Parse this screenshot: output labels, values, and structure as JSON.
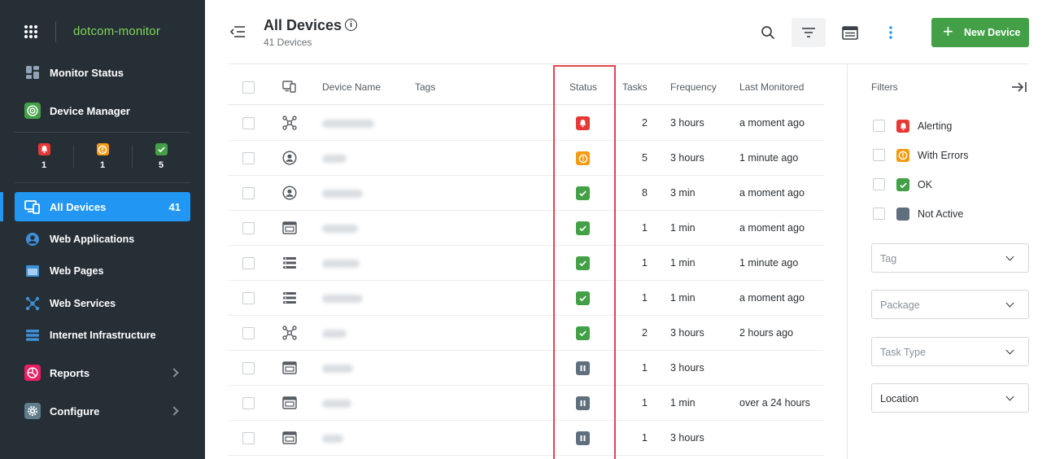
{
  "sidebar": {
    "logo_left": "dotcom",
    "logo_dash": "-",
    "logo_right": "monitor",
    "items": [
      {
        "label": "Monitor Status",
        "icon": "dashboard-icon"
      },
      {
        "label": "Device Manager",
        "icon": "target-icon"
      }
    ],
    "status_counts": [
      {
        "name": "alerting",
        "count": "1",
        "color": "#e53935"
      },
      {
        "name": "errors",
        "count": "1",
        "color": "#f39c12"
      },
      {
        "name": "ok",
        "count": "5",
        "color": "#43a047"
      }
    ],
    "devices": [
      {
        "label": "All Devices",
        "count": "41"
      },
      {
        "label": "Web Applications"
      },
      {
        "label": "Web Pages"
      },
      {
        "label": "Web Services"
      },
      {
        "label": "Internet Infrastructure"
      }
    ],
    "bottom": [
      {
        "label": "Reports"
      },
      {
        "label": "Configure"
      }
    ]
  },
  "header": {
    "title": "All Devices",
    "subtitle": "41 Devices",
    "info": "i",
    "new_device_plus": "+",
    "new_device_label": "New Device"
  },
  "table": {
    "columns": {
      "name": "Device Name",
      "tags": "Tags",
      "status": "Status",
      "tasks": "Tasks",
      "frequency": "Frequency",
      "last": "Last Monitored"
    },
    "rows": [
      {
        "type": "web-service-icon",
        "status": "alerting",
        "tasks": "2",
        "frequency": "3 hours",
        "last": "a moment ago"
      },
      {
        "type": "web-application-icon",
        "status": "errors",
        "tasks": "5",
        "frequency": "3 hours",
        "last": "1 minute ago"
      },
      {
        "type": "web-application-icon",
        "status": "ok",
        "tasks": "8",
        "frequency": "3 min",
        "last": "a moment ago"
      },
      {
        "type": "web-page-icon",
        "status": "ok",
        "tasks": "1",
        "frequency": "1 min",
        "last": "a moment ago"
      },
      {
        "type": "infrastructure-icon",
        "status": "ok",
        "tasks": "1",
        "frequency": "1 min",
        "last": "1 minute ago"
      },
      {
        "type": "infrastructure-icon",
        "status": "ok",
        "tasks": "1",
        "frequency": "1 min",
        "last": "a moment ago"
      },
      {
        "type": "web-service-icon",
        "status": "ok",
        "tasks": "2",
        "frequency": "3 hours",
        "last": "2 hours ago"
      },
      {
        "type": "web-page-icon",
        "status": "paused",
        "tasks": "1",
        "frequency": "3 hours",
        "last": ""
      },
      {
        "type": "web-page-icon",
        "status": "paused",
        "tasks": "1",
        "frequency": "1 min",
        "last": "over a 24 hours"
      },
      {
        "type": "web-page-icon",
        "status": "paused",
        "tasks": "1",
        "frequency": "3 hours",
        "last": ""
      }
    ]
  },
  "filters": {
    "title": "Filters",
    "options": [
      {
        "label": "Alerting",
        "status": "alerting"
      },
      {
        "label": "With Errors",
        "status": "errors"
      },
      {
        "label": "OK",
        "status": "ok"
      },
      {
        "label": "Not Active",
        "status": "inactive"
      }
    ],
    "selects": [
      {
        "placeholder": "Tag",
        "value": ""
      },
      {
        "placeholder": "Package",
        "value": ""
      },
      {
        "placeholder": "Task Type",
        "value": ""
      },
      {
        "placeholder": "",
        "value": "Location"
      }
    ]
  },
  "colors": {
    "sidebar_bg": "#262e36",
    "accent": "#2196f3",
    "alerting": "#e53935",
    "errors": "#f39c12",
    "ok": "#43a047",
    "paused": "#5f6f7d",
    "highlight": "#e0484c"
  }
}
